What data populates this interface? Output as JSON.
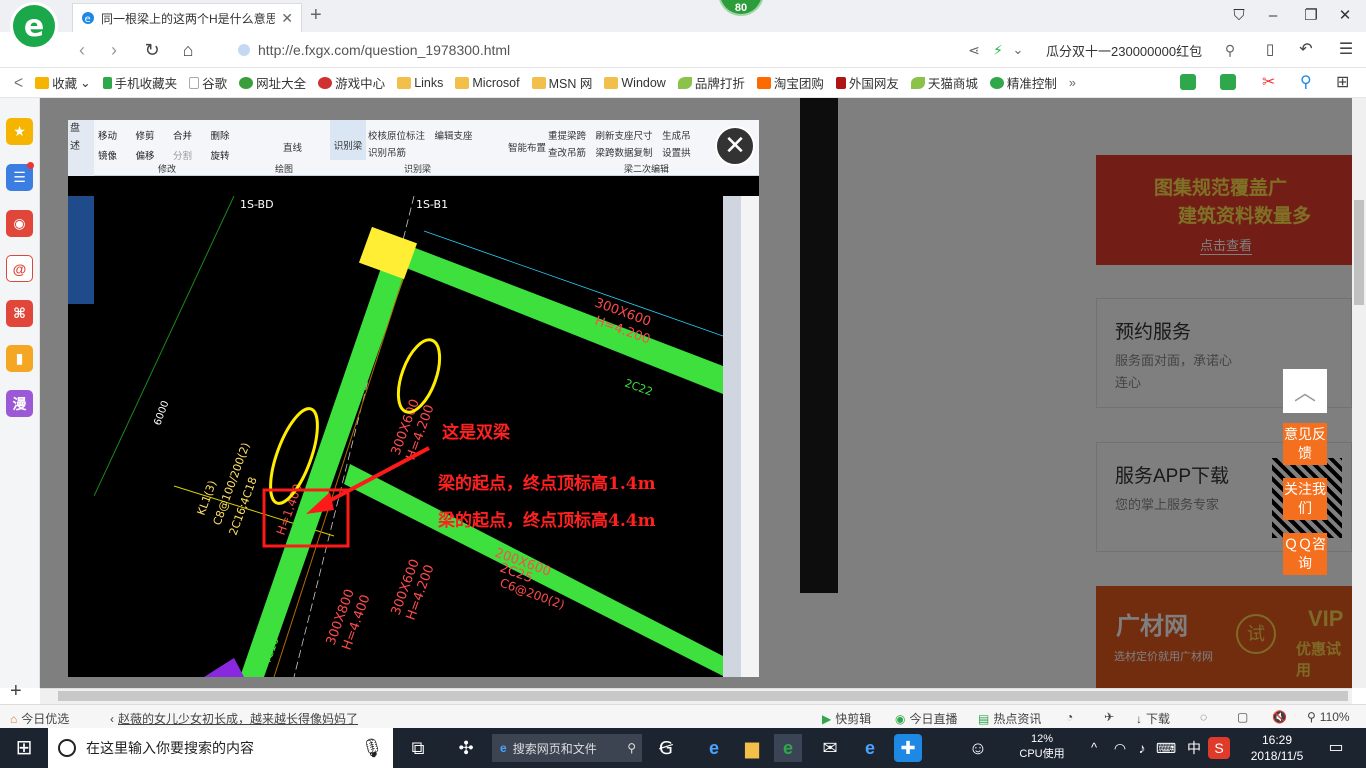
{
  "browser": {
    "tab_title": "同一根梁上的这两个H是什么意思",
    "badge": "80",
    "url": "http://e.fxgx.com/question_1978300.html",
    "search_text": "瓜分双十一230000000红包"
  },
  "bookmarks": [
    {
      "label": "收藏",
      "color": "#f5b400"
    },
    {
      "label": "手机收藏夹",
      "color": "#2ea84a"
    },
    {
      "label": "谷歌",
      "color": "#aaaaaa"
    },
    {
      "label": "网址大全",
      "color": "#3a9f3a"
    },
    {
      "label": "游戏中心",
      "color": "#d03030"
    },
    {
      "label": "Links",
      "color": "#f2c04a"
    },
    {
      "label": "Microsof",
      "color": "#f2c04a"
    },
    {
      "label": "MSN 网",
      "color": "#f2c04a"
    },
    {
      "label": "Window",
      "color": "#f2c04a"
    },
    {
      "label": "品牌打折",
      "color": "#8bc34a"
    },
    {
      "label": "淘宝团购",
      "color": "#ff6a00"
    },
    {
      "label": "外国网友",
      "color": "#b01515"
    },
    {
      "label": "天猫商城",
      "color": "#8bc34a"
    },
    {
      "label": "精准控制",
      "color": "#2ea84a"
    }
  ],
  "page": {
    "banner_text_1": "图集规范覆盖广",
    "banner_text_2": "建筑资料数量多",
    "banner_btn": "点击查看",
    "service_title": "预约服务",
    "service_desc": "服务面对面，承诺心连心",
    "app_title": "服务APP下载",
    "app_desc": "您的掌上服务专家",
    "ad_brand": "广材网",
    "ad_sub": "选材定价就用广材网",
    "ad_try": "试",
    "ad_vip": "VIP",
    "ad_vip_sub": "优惠试用"
  },
  "float_buttons": [
    "意见反馈",
    "关注我们",
    "ＱＱ咨询"
  ],
  "cad": {
    "ribbon": {
      "items_left": [
        "移动",
        "修剪",
        "合并",
        "删除",
        "镜像",
        "偏移",
        "分割",
        "旋转"
      ],
      "group_modify": "修改",
      "draw_line": "直线",
      "group_draw": "绘图",
      "identify_beam": "识别梁",
      "check_mark": "校核原位标注",
      "edit_support": "编辑支座",
      "identify_hanger": "识别吊筋",
      "group_identify": "识别梁",
      "smart_layout": "智能布置",
      "extract_span": "重提梁跨",
      "refresh_support": "刷新支座尺寸",
      "gen_tag": "生成吊",
      "check_span": "查改吊筋",
      "copy_span_data": "梁跨数据复制",
      "set_arch": "设置拱",
      "group_secondary": "梁二次编辑",
      "left_panel": [
        "盘",
        "述"
      ]
    },
    "axis_labels": [
      "1S-BD",
      "1S-B1"
    ],
    "beam_labels": [
      "3C16",
      "300X600",
      "H=4.200",
      "2C22",
      "4C16",
      "300X600",
      "H=4.200",
      "KL1(3)",
      "C8@100/200(2)",
      "2C16;4C18",
      "H=1.400",
      "300X600",
      "H=4.200",
      "200X600",
      "2C25",
      "C6@200(2)",
      "300X800",
      "H=4.400",
      "4C16",
      "6000"
    ],
    "annotation_1": "这是双梁",
    "annotation_2": "梁的起点，终点顶标高1.4m",
    "annotation_3": "梁的起点，终点顶标高4.4m"
  },
  "statusbar": {
    "today": "今日优选",
    "news": "赵薇的女儿少女初长成，越来越长得像妈妈了",
    "quick_cut": "快剪辑",
    "live": "今日直播",
    "hot": "热点资讯",
    "download": "下载",
    "zoom": "110%"
  },
  "taskbar": {
    "search_placeholder": "在这里输入你要搜索的内容",
    "web_search": "搜索网页和文件",
    "cpu_percent": "12%",
    "cpu_label": "CPU使用",
    "ime": "中",
    "time": "16:29",
    "date": "2018/11/5"
  }
}
